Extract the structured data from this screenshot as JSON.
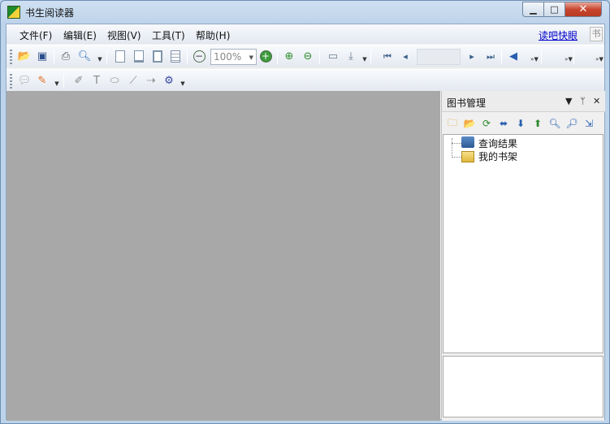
{
  "window": {
    "title": "书生阅读器"
  },
  "menu": {
    "items": [
      "文件(F)",
      "编辑(E)",
      "视图(V)",
      "工具(T)",
      "帮助(H)"
    ],
    "link": "读吧快眼",
    "grip_text": "书"
  },
  "toolbar": {
    "zoom_value": "100%"
  },
  "panel": {
    "title": "图书管理",
    "tree": [
      "查询结果",
      "我的书架"
    ]
  },
  "colors": {
    "accent": "#1e8a2c",
    "page_bg": "#a8a8a8",
    "link": "#0000cc"
  }
}
